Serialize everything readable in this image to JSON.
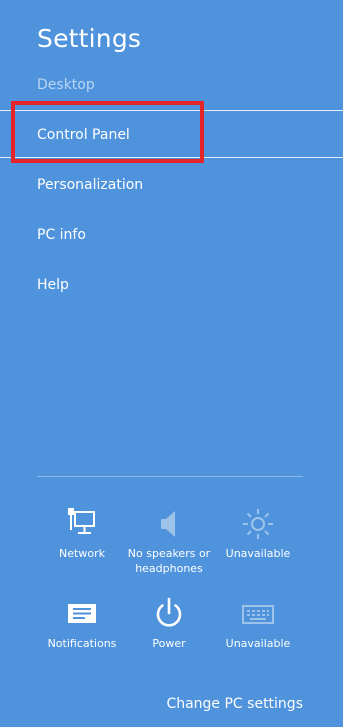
{
  "header": {
    "title": "Settings",
    "subtitle": "Desktop"
  },
  "menu": {
    "items": [
      {
        "label": "Control Panel"
      },
      {
        "label": "Personalization"
      },
      {
        "label": "PC info"
      },
      {
        "label": "Help"
      }
    ]
  },
  "quick": {
    "row1": [
      {
        "label": "Network",
        "icon": "network-icon"
      },
      {
        "label": "No speakers or headphones",
        "icon": "speaker-icon"
      },
      {
        "label": "Unavailable",
        "icon": "brightness-icon"
      }
    ],
    "row2": [
      {
        "label": "Notifications",
        "icon": "notifications-icon"
      },
      {
        "label": "Power",
        "icon": "power-icon"
      },
      {
        "label": "Unavailable",
        "icon": "keyboard-icon"
      }
    ]
  },
  "footer": {
    "change_pc_settings": "Change PC settings"
  },
  "colors": {
    "background": "#4f93dc",
    "highlight": "#e5242a"
  }
}
